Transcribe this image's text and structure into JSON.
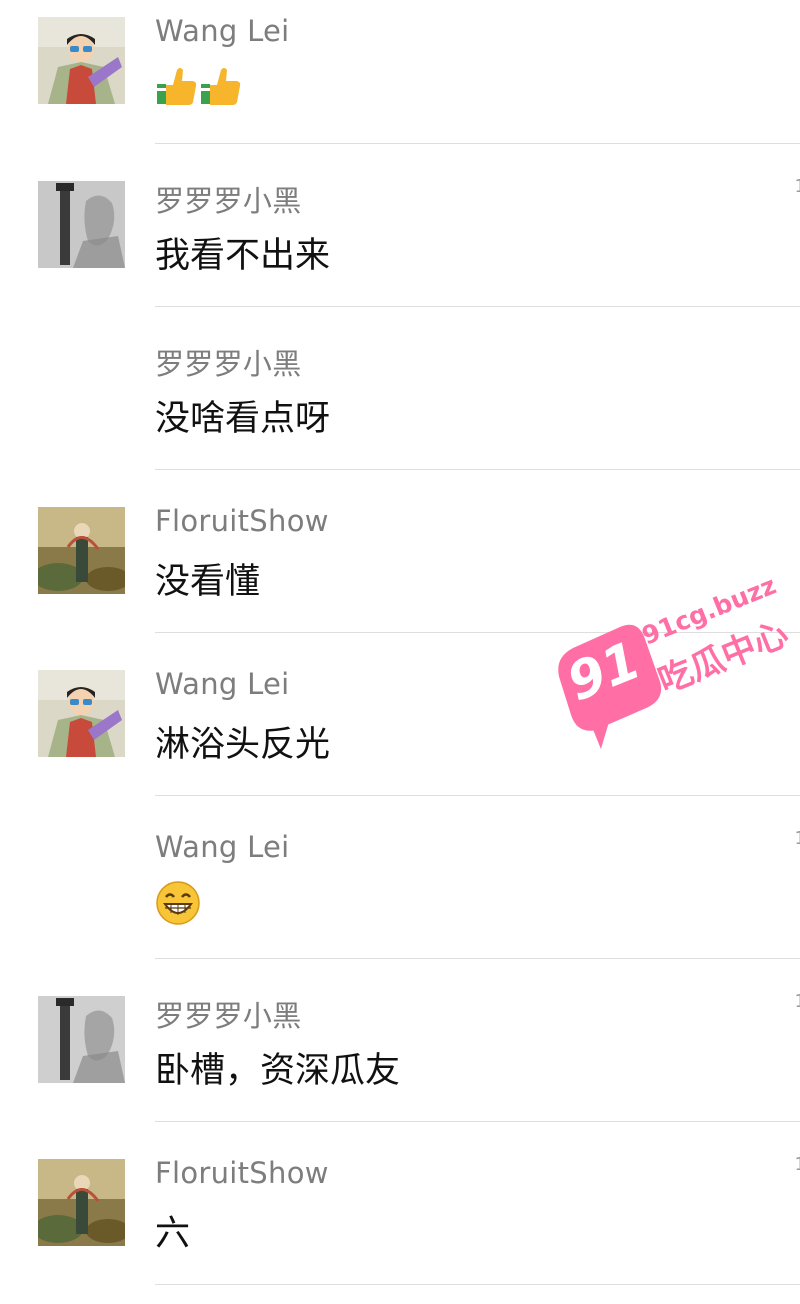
{
  "comments": [
    {
      "name": "Wang Lei",
      "text": "",
      "emoji": "thumbs-up-icon",
      "emoji_count": 2,
      "avatar": "avatar-wanglei",
      "show_avatar": true
    },
    {
      "name": "罗罗罗小黑",
      "text": "我看不出来",
      "avatar": "avatar-luo",
      "show_avatar": true
    },
    {
      "name": "罗罗罗小黑",
      "text": "没啥看点呀",
      "avatar": "avatar-luo",
      "show_avatar": false
    },
    {
      "name": "FloruitShow",
      "text": "没看懂",
      "avatar": "avatar-floruit",
      "show_avatar": true
    },
    {
      "name": "Wang Lei",
      "text": "淋浴头反光",
      "avatar": "avatar-wanglei",
      "show_avatar": true
    },
    {
      "name": "Wang Lei",
      "text": "",
      "emoji": "grin-icon",
      "emoji_count": 1,
      "avatar": "avatar-wanglei",
      "show_avatar": false
    },
    {
      "name": "罗罗罗小黑",
      "text": "卧槽，资深瓜友",
      "avatar": "avatar-luo",
      "show_avatar": true
    },
    {
      "name": "FloruitShow",
      "text": "六",
      "avatar": "avatar-floruit",
      "show_avatar": true
    }
  ],
  "watermark": {
    "badge": "91",
    "site": "91cg.buzz",
    "label": "吃瓜中心",
    "color": "#ff6fa6"
  },
  "colors": {
    "name": "#7d7d7d",
    "message": "#111111",
    "divider": "#dedede"
  }
}
